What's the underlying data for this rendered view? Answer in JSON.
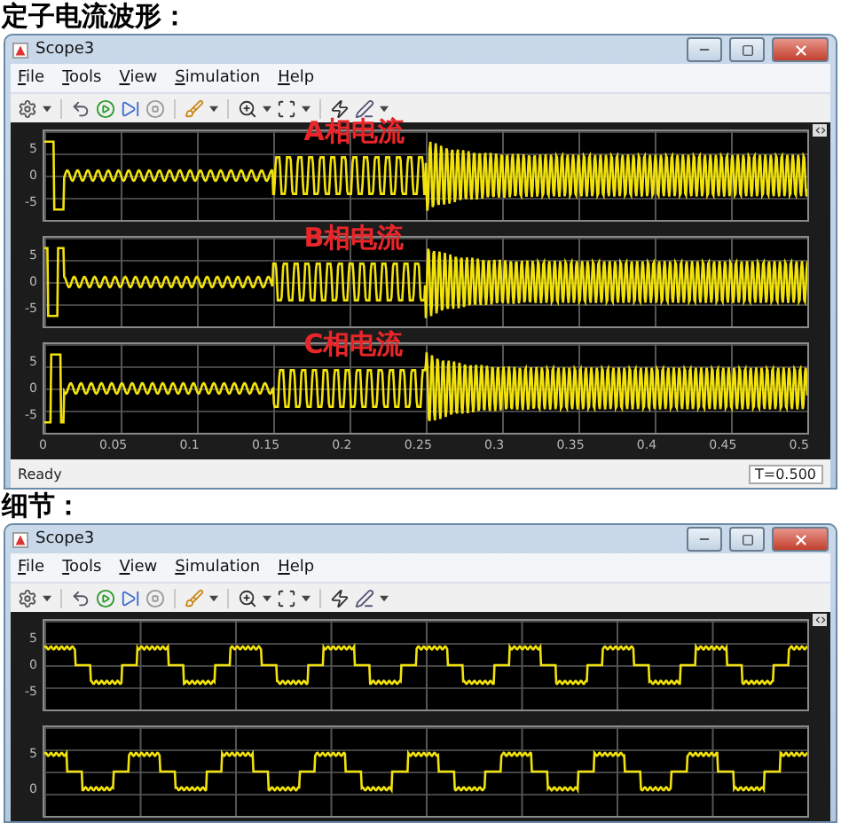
{
  "sections": [
    {
      "heading": "定子电流波形：",
      "scope": {
        "title": "Scope3",
        "menu": [
          "File",
          "Tools",
          "View",
          "Simulation",
          "Help"
        ],
        "plots": [
          {
            "kind": "transient",
            "label": "A相电流",
            "y_ticks": [
              "5",
              "0",
              "-5"
            ]
          },
          {
            "kind": "transient",
            "label": "B相电流",
            "y_ticks": [
              "5",
              "0",
              "-5"
            ]
          },
          {
            "kind": "transient",
            "label": "C相电流",
            "y_ticks": [
              "5",
              "0",
              "-5"
            ]
          }
        ],
        "x_ticks": [
          "0",
          "0.05",
          "0.1",
          "0.15",
          "0.2",
          "0.25",
          "0.3",
          "0.35",
          "0.4",
          "0.45",
          "0.5"
        ],
        "status": {
          "text": "Ready",
          "time": "T=0.500"
        }
      }
    },
    {
      "heading": "细节：",
      "scope": {
        "title": "Scope3",
        "menu": [
          "File",
          "Tools",
          "View",
          "Simulation",
          "Help"
        ],
        "plots": [
          {
            "kind": "detail",
            "y_ticks": [
              "5",
              "0",
              "-5"
            ]
          },
          {
            "kind": "detail",
            "y_ticks": [
              "5",
              "0"
            ]
          }
        ]
      }
    }
  ]
}
